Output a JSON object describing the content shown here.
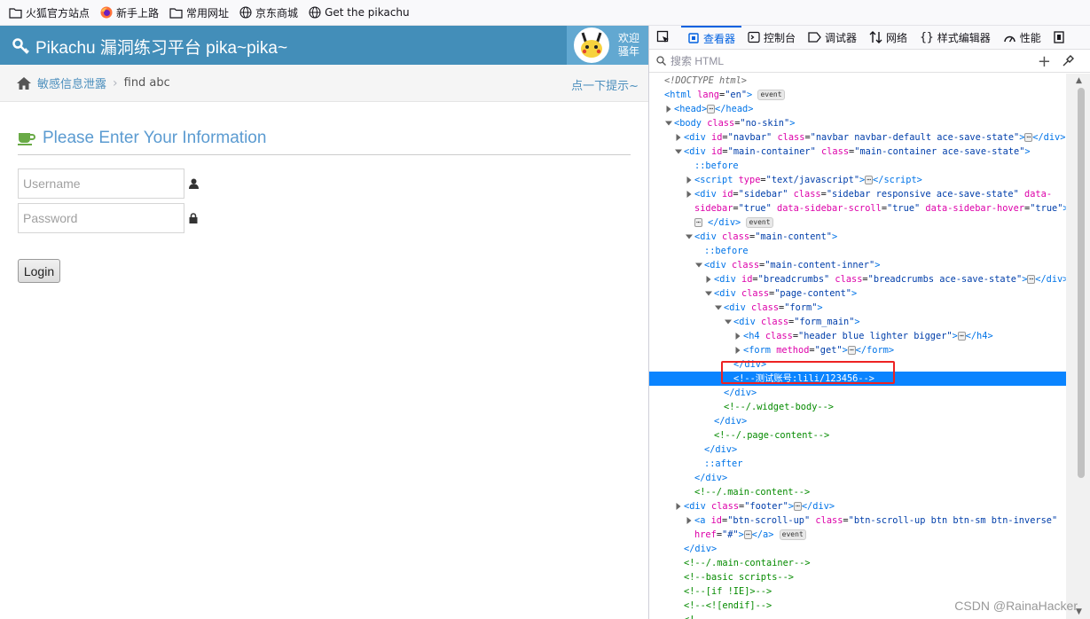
{
  "bookmarks": [
    {
      "label": "火狐官方站点",
      "icon": "folder-icon"
    },
    {
      "label": "新手上路",
      "icon": "firefox-icon"
    },
    {
      "label": "常用网址",
      "icon": "folder-icon"
    },
    {
      "label": "京东商城",
      "icon": "globe-icon"
    },
    {
      "label": "Get the pikachu",
      "icon": "globe-icon"
    }
  ],
  "navbar": {
    "brand": "Pikachu 漏洞练习平台 pika~pika~",
    "welcome": "欢迎 骚年",
    "brand_color": "#438eb9"
  },
  "breadcrumbs": {
    "section": "敏感信息泄露",
    "current": "find abc",
    "hint": "点一下提示~"
  },
  "form": {
    "title": "Please Enter Your Information",
    "username_placeholder": "Username",
    "password_placeholder": "Password",
    "login_label": "Login"
  },
  "devtools": {
    "tabs": [
      "查看器",
      "控制台",
      "调试器",
      "网络",
      "样式编辑器",
      "性能"
    ],
    "active_tab": "查看器",
    "search_placeholder": "搜索 HTML",
    "selected_line_text": "<!--测试账号:lili/123456-->"
  },
  "watermark": "CSDN @RainaHacker"
}
